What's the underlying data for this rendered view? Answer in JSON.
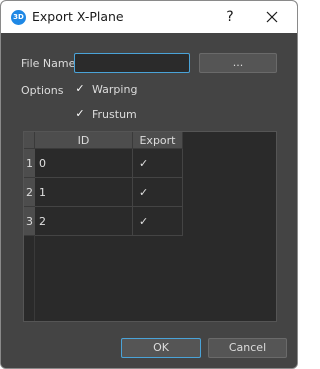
{
  "window": {
    "title": "Export X-Plane",
    "app_icon_text": "3D",
    "help_label": "?"
  },
  "form": {
    "file_name_label": "File Name",
    "file_name_value": "",
    "browse_label": "...",
    "options_label": "Options",
    "warping_label": "Warping",
    "warping_checked": true,
    "frustum_label": "Frustum",
    "frustum_checked": true
  },
  "table": {
    "columns": [
      "ID",
      "Export"
    ],
    "rows": [
      {
        "row_header": "1",
        "id": "0",
        "export": true
      },
      {
        "row_header": "2",
        "id": "1",
        "export": true
      },
      {
        "row_header": "3",
        "id": "2",
        "export": true
      }
    ]
  },
  "buttons": {
    "ok_label": "OK",
    "cancel_label": "Cancel"
  },
  "colors": {
    "accent": "#4aa3d8",
    "app_icon": "#1e88e5"
  }
}
